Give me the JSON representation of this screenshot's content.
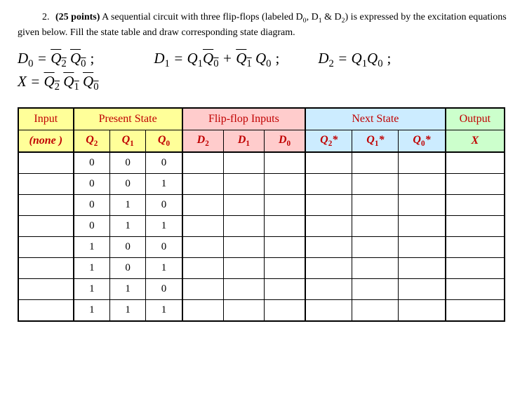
{
  "question": {
    "number": "2.",
    "points": "(25 points)",
    "text_part1": "A sequential circuit with three flip-flops (labeled D",
    "sub0": "0",
    "text_part2": ", D",
    "sub1": "1",
    "text_part3": " & D",
    "sub2": "2",
    "text_part4": ") is expressed by the excitation equations given below. Fill the state table and draw corresponding state diagram."
  },
  "equations": {
    "d0_lhs": "D",
    "d0_sub": "0",
    "eq_sign": " = ",
    "q2bar": "Q",
    "q2bar_sub": "2",
    "q0bar": "Q",
    "q0bar_sub": "0",
    "d1_lhs": "D",
    "d1_sub": "1",
    "q1": "Q",
    "q1_sub": "1",
    "q0": "Q",
    "q0_sub": "0",
    "plus": " + ",
    "d2_lhs": "D",
    "d2_sub": "2",
    "x_lhs": "X",
    "semicolon": ";"
  },
  "table": {
    "group_headers": {
      "input": "Input",
      "present_state": "Present State",
      "flip_flop_inputs": "Flip-flop Inputs",
      "next_state": "Next State",
      "output": "Output"
    },
    "sub_headers": {
      "none": "none",
      "q2": "Q",
      "q2_sub": "2",
      "q1": "Q",
      "q1_sub": "1",
      "q0": "Q",
      "q0_sub": "0",
      "d2": "D",
      "d2_sub": "2",
      "d1": "D",
      "d1_sub": "1",
      "d0": "D",
      "d0_sub": "0",
      "q2s": "Q",
      "q2s_sub": "2",
      "star": "*",
      "q1s": "Q",
      "q1s_sub": "1",
      "q0s": "Q",
      "q0s_sub": "0",
      "x": "X"
    },
    "rows": [
      {
        "q2": "0",
        "q1": "0",
        "q0": "0"
      },
      {
        "q2": "0",
        "q1": "0",
        "q0": "1"
      },
      {
        "q2": "0",
        "q1": "1",
        "q0": "0"
      },
      {
        "q2": "0",
        "q1": "1",
        "q0": "1"
      },
      {
        "q2": "1",
        "q1": "0",
        "q0": "0"
      },
      {
        "q2": "1",
        "q1": "0",
        "q0": "1"
      },
      {
        "q2": "1",
        "q1": "1",
        "q0": "0"
      },
      {
        "q2": "1",
        "q1": "1",
        "q0": "1"
      }
    ]
  }
}
